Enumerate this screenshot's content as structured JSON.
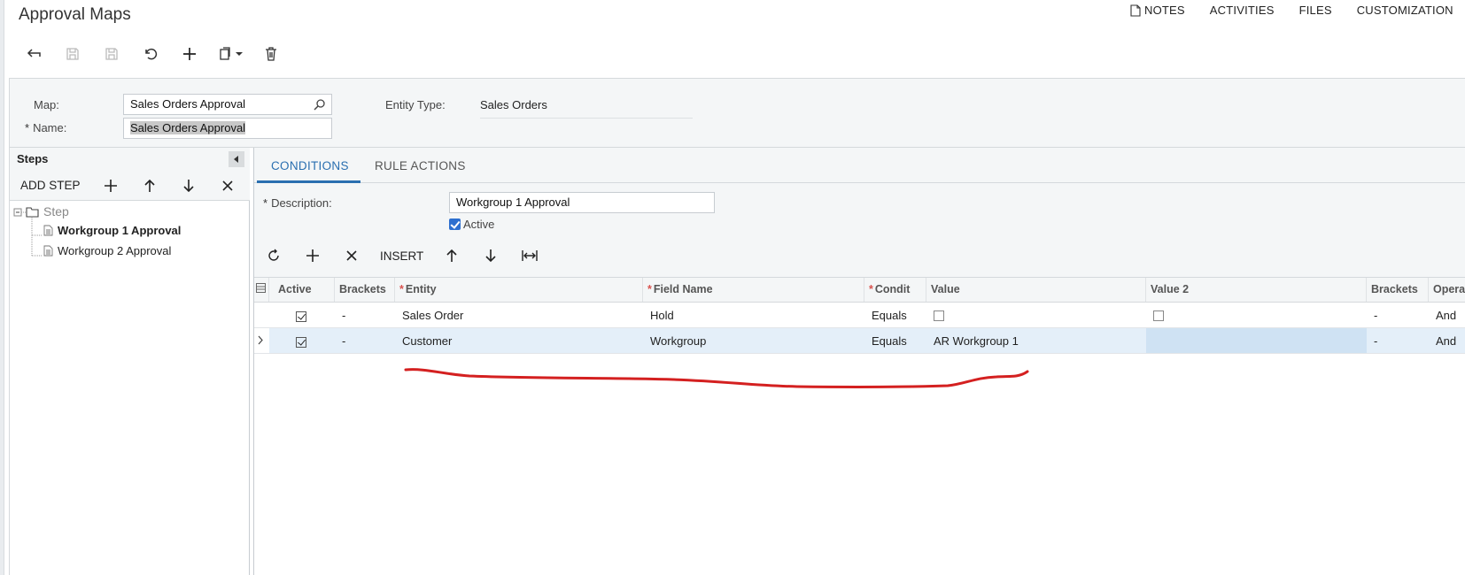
{
  "page": {
    "title": "Approval Maps"
  },
  "top_links": {
    "notes": "NOTES",
    "activities": "ACTIVITIES",
    "files": "FILES",
    "customization": "CUSTOMIZATION",
    "truncated": "T"
  },
  "toolbar_icons": [
    "back-arrow-icon",
    "save-close-icon",
    "save-icon",
    "undo-icon",
    "plus-icon",
    "copy-paste-icon",
    "delete-icon"
  ],
  "header_form": {
    "map_label": "Map:",
    "map_value": "Sales Orders Approval",
    "name_label": "Name:",
    "name_value": "Sales Orders Approval",
    "entity_type_label": "Entity Type:",
    "entity_type_value": "Sales Orders"
  },
  "steps_panel": {
    "title": "Steps",
    "add_step": "ADD STEP",
    "tree": {
      "root": "Step",
      "items": [
        "Workgroup 1 Approval",
        "Workgroup 2 Approval"
      ]
    }
  },
  "tabs": [
    "CONDITIONS",
    "RULE ACTIONS"
  ],
  "conditions": {
    "description_label": "Description:",
    "description_value": "Workgroup 1 Approval",
    "active_label": "Active",
    "insert_label": "INSERT"
  },
  "grid": {
    "columns": [
      "Active",
      "Brackets",
      "Entity",
      "Field Name",
      "Condit",
      "Value",
      "Value 2",
      "Brackets",
      "Opera"
    ],
    "rows": [
      {
        "active": true,
        "brackets": "-",
        "entity": "Sales Order",
        "field": "Hold",
        "condition": "Equals",
        "value": "",
        "value2": "",
        "brackets2": "-",
        "operator": "And"
      },
      {
        "active": true,
        "brackets": "-",
        "entity": "Customer",
        "field": "Workgroup",
        "condition": "Equals",
        "value": "AR Workgroup 1",
        "value2": "",
        "brackets2": "-",
        "operator": "And"
      }
    ]
  },
  "colors": {
    "accent": "#2a6fb0",
    "annotation": "#d42020",
    "selected_row": "#e4eff9"
  }
}
